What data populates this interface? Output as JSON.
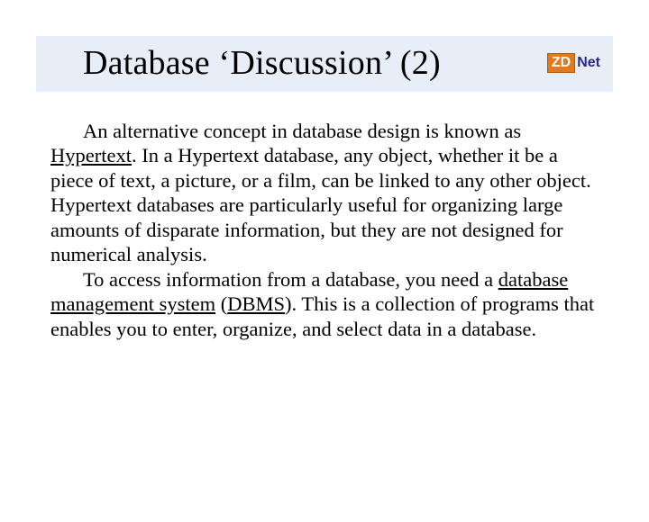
{
  "title": "Database ‘Discussion’ (2)",
  "logo": {
    "zd": "ZD",
    "net": "Net"
  },
  "para1": {
    "t1": "An alternative concept in database design is known as ",
    "u1": "Hypertext",
    "t2": ". In a Hypertext database, any object, whether it be a piece of text, a picture, or a film, can be linked to any other object. Hypertext databases are particularly useful for organizing large amounts of disparate information, but they are not designed for numerical analysis."
  },
  "para2": {
    "t1": " To access information from a database, you need a ",
    "u1": "database management system",
    "t2": " (",
    "u2": "DBMS",
    "t3": "). This is a collection of programs that enables you to enter, organize, and select data in a database."
  }
}
